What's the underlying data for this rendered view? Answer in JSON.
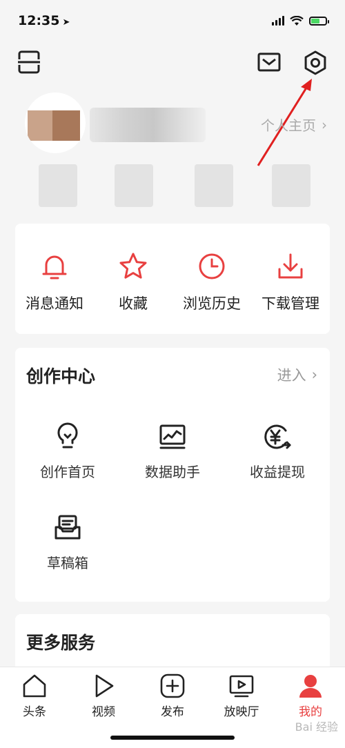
{
  "status_bar": {
    "time": "12:35",
    "location_glyph": "➤",
    "battery_color": "#4cd964"
  },
  "topbar": {
    "scan_icon": "scan-icon",
    "mail_icon": "mail-icon",
    "settings_icon": "gear-icon"
  },
  "profile": {
    "homepage_label": "个人主页",
    "chevron": "›"
  },
  "quick_actions": [
    {
      "label": "消息通知",
      "icon": "bell-icon"
    },
    {
      "label": "收藏",
      "icon": "star-icon"
    },
    {
      "label": "浏览历史",
      "icon": "clock-icon"
    },
    {
      "label": "下载管理",
      "icon": "download-icon"
    }
  ],
  "creator_center": {
    "title": "创作中心",
    "enter_label": "进入",
    "chevron": "›",
    "items": [
      {
        "label": "创作首页",
        "icon": "lightbulb-icon"
      },
      {
        "label": "数据助手",
        "icon": "chart-monitor-icon"
      },
      {
        "label": "收益提现",
        "icon": "yuan-withdraw-icon"
      },
      {
        "label": "草稿箱",
        "icon": "draft-box-icon"
      }
    ]
  },
  "more_services": {
    "title": "更多服务"
  },
  "tabbar": {
    "tabs": [
      {
        "label": "头条",
        "icon": "home-icon"
      },
      {
        "label": "视频",
        "icon": "play-icon"
      },
      {
        "label": "发布",
        "icon": "plus-icon"
      },
      {
        "label": "放映厅",
        "icon": "tv-icon"
      },
      {
        "label": "我的",
        "icon": "user-icon"
      }
    ],
    "active_color": "#e84040"
  },
  "watermark": "Bai 经验",
  "accent_color": "#e84040"
}
